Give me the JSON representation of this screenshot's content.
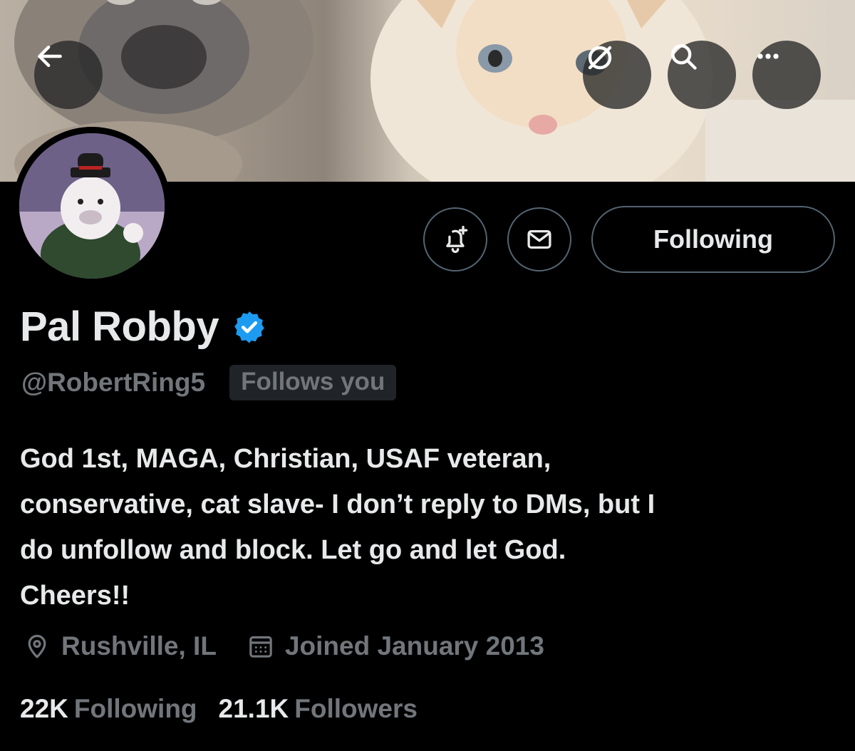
{
  "header": {
    "back_icon": "arrow-left-icon",
    "grok_icon": "grok-icon",
    "search_icon": "search-icon",
    "more_icon": "more-dots-icon"
  },
  "profile": {
    "name": "Pal Robby",
    "verified": true,
    "verified_color": "#1d9bf0",
    "handle": "@RobertRing5",
    "follows_you_badge": "Follows you",
    "bio_lines": [
      "God 1st, MAGA, Christian, USAF veteran,",
      "conservative, cat slave- I don’t reply to DMs, but I",
      "do unfollow and block. Let go and let God.",
      "Cheers!!"
    ],
    "location": "Rushville, IL",
    "joined": "Joined January 2013",
    "following_count": "22K",
    "following_label": "Following",
    "followers_count": "21.1K",
    "followers_label": "Followers"
  },
  "actions": {
    "notify_icon": "bell-plus-icon",
    "message_icon": "envelope-icon",
    "follow_button_label": "Following"
  },
  "colors": {
    "background": "#000000",
    "primary_text": "#e7e9ea",
    "secondary_text": "#71767b",
    "border": "#536471"
  }
}
